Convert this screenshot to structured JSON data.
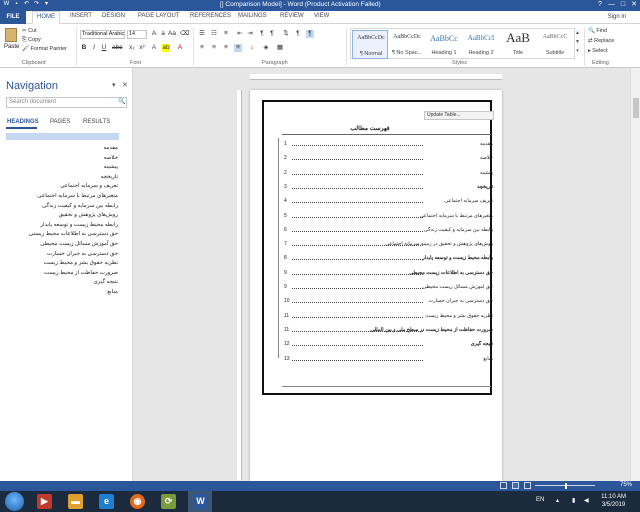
{
  "window": {
    "title": "[] Comparison Model] - Word (Product Activation Failed)",
    "signin": "Sign in",
    "controls": [
      "?",
      "—",
      "□",
      "✕"
    ]
  },
  "ribbon_tabs": [
    "FILE",
    "HOME",
    "INSERT",
    "DESIGN",
    "PAGE LAYOUT",
    "REFERENCES",
    "MAILINGS",
    "REVIEW",
    "VIEW"
  ],
  "active_tab": "HOME",
  "clipboard": {
    "paste": "Paste",
    "cut": "Cut",
    "copy": "Copy",
    "format_painter": "Format Painter",
    "label": "Clipboard"
  },
  "font": {
    "family": "Traditional Arabic",
    "size": "14",
    "label": "Font"
  },
  "paragraph": {
    "label": "Paragraph"
  },
  "styles": {
    "label": "Styles",
    "items": [
      {
        "sample": "AaBbCcDc",
        "name": "¶ Normal"
      },
      {
        "sample": "AaBbCcDc",
        "name": "¶ No Spac..."
      },
      {
        "sample": "AaBbCc",
        "name": "Heading 1"
      },
      {
        "sample": "AaBbCcI",
        "name": "Heading 2"
      },
      {
        "sample": "AaB",
        "name": "Title"
      },
      {
        "sample": "AaBbCcC",
        "name": "Subtitle"
      }
    ]
  },
  "editing": {
    "find": "Find",
    "replace": "Replace",
    "select": "Select",
    "label": "Editing"
  },
  "navigation": {
    "title": "Navigation",
    "search_placeholder": "Search document",
    "tabs": [
      "HEADINGS",
      "PAGES",
      "RESULTS"
    ],
    "headings": [
      "مقدمه",
      "خلاصه",
      "پیشینه",
      "تاریخچه",
      "تعریف و سرمایه اجتماعی",
      "متغیرهای مرتبط با سرمایه اجتماعی",
      "رابطه بین سرمایه و کیفیت زندگی",
      "روش‌های پژوهش و تحقیق",
      "رابطه محیط زیست و توسعه پایدار",
      "حق دسترسی به اطلاعات محیط زیستی",
      "حق آموزش مسائل زیست محیطی",
      "حق دسترسی به جبران خسارت",
      "نظریه حقوق بشر و محیط زیست",
      "ضرورت حفاظت از محیط زیست",
      "نتیجه گیری",
      "منابع"
    ]
  },
  "document": {
    "update_table": "Update Table...",
    "toc_title": "فهرست مطالب",
    "toc": [
      {
        "text": "مقدمه",
        "page": "1",
        "bold": false
      },
      {
        "text": "خلاصه",
        "page": "2",
        "bold": false
      },
      {
        "text": "پیشینه",
        "page": "2",
        "bold": false
      },
      {
        "text": "تاریخچه",
        "page": "3",
        "bold": true
      },
      {
        "text": "تعریف سرمایه اجتماعی",
        "page": "4",
        "bold": false
      },
      {
        "text": "متغیرهای مرتبط با سرمایه اجتماعی",
        "page": "5",
        "bold": false
      },
      {
        "text": "رابطه بین سرمایه و کیفیت زندگی",
        "page": "6",
        "bold": false
      },
      {
        "text": "روش‌های پژوهش و تحقیق در زمینه سرمایه اجتماعی",
        "page": "7",
        "bold": false
      },
      {
        "text": "رابطه محیط زیست و توسعه پایدار",
        "page": "8",
        "bold": true
      },
      {
        "text": "حق دسترسی به اطلاعات زیست محیطی",
        "page": "9",
        "bold": true
      },
      {
        "text": "حق آموزش مسائل زیست محیطی",
        "page": "9",
        "bold": false
      },
      {
        "text": "حق دسترسی به جبران خسارت",
        "page": "10",
        "bold": false
      },
      {
        "text": "نظریه حقوق بشر و محیط زیست",
        "page": "11",
        "bold": false
      },
      {
        "text": "ضرورت حفاظت از محیط زیست در سطح ملی و بین المللی",
        "page": "11",
        "bold": true
      },
      {
        "text": "نتیجه گیری",
        "page": "12",
        "bold": true
      },
      {
        "text": "منابع",
        "page": "13",
        "bold": false
      }
    ]
  },
  "status": {
    "zoom": "75%"
  },
  "taskbar": {
    "lang": "EN",
    "time": "11:10 AM",
    "date": "3/5/2019"
  },
  "colors": {
    "word_blue": "#2b579a",
    "taskbar": "#1b2b3d"
  }
}
